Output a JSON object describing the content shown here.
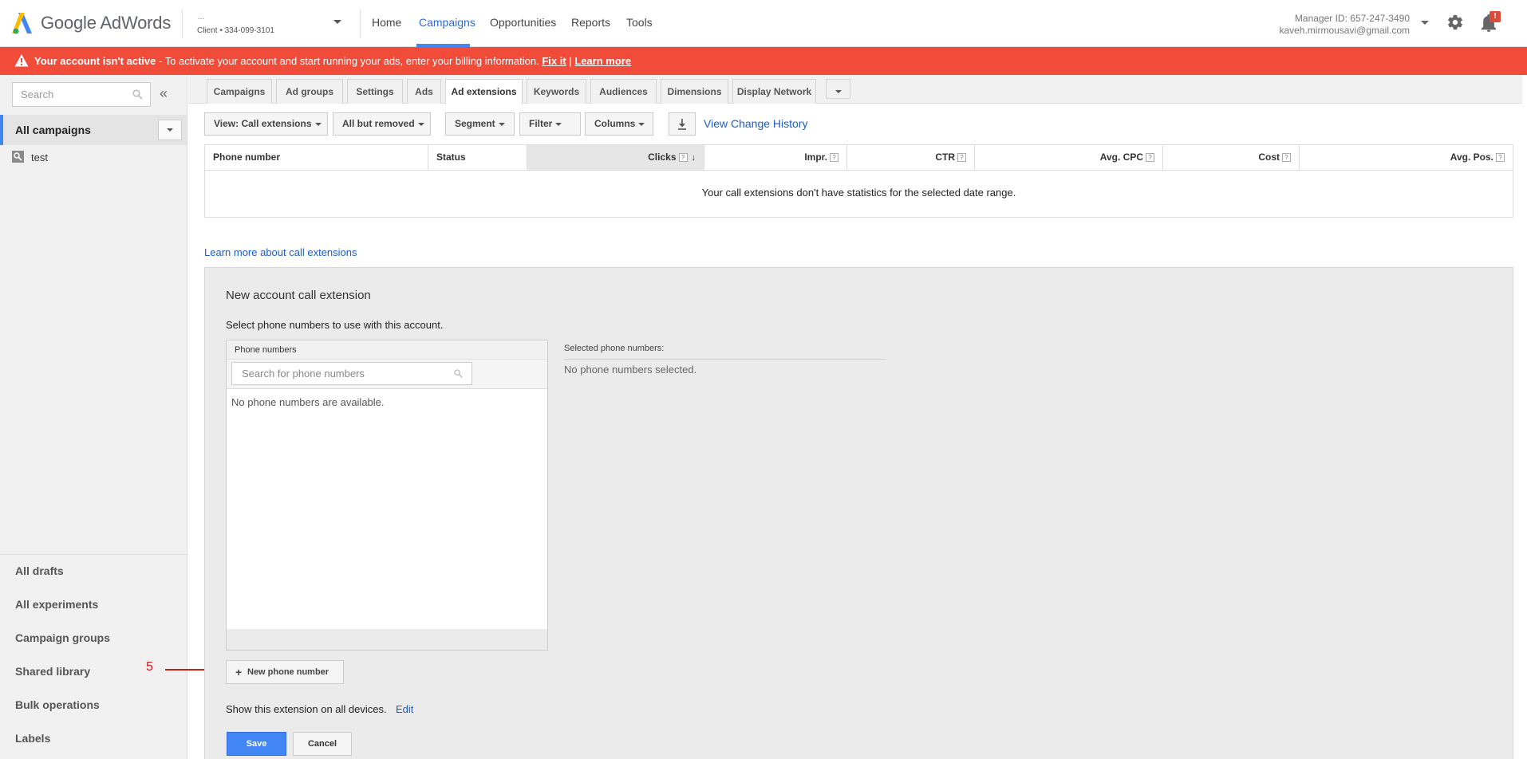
{
  "header": {
    "brand": "Google AdWords",
    "account_name": "...",
    "account_client": "Client  •  334-099-3101",
    "nav": [
      "Home",
      "Campaigns",
      "Opportunities",
      "Reports",
      "Tools"
    ],
    "active_nav": "Campaigns",
    "manager_id": "Manager ID: 657-247-3490",
    "manager_email": "kaveh.mirmousavi@gmail.com",
    "notification_badge": "!"
  },
  "alert": {
    "bold": "Your account isn't active",
    "text": " - To activate your account and start running your ads, enter your billing information. ",
    "fix_link": "Fix it",
    "separator": " | ",
    "learn_link": "Learn more",
    "color": "#f14c3a"
  },
  "sidebar": {
    "search_placeholder": "Search",
    "collapse_glyph": "«",
    "all_campaigns": "All campaigns",
    "campaigns": [
      "test"
    ],
    "bottom_items": [
      "All drafts",
      "All experiments",
      "Campaign groups",
      "Shared library",
      "Bulk operations",
      "Labels"
    ]
  },
  "tabs": [
    "Campaigns",
    "Ad groups",
    "Settings",
    "Ads",
    "Ad extensions",
    "Keywords",
    "Audiences",
    "Dimensions",
    "Display Network"
  ],
  "active_tab": "Ad extensions",
  "toolbar": {
    "view": "View: Call extensions",
    "filter_state": "All but removed",
    "segment": "Segment",
    "filter": "Filter",
    "columns": "Columns",
    "change_history": "View Change History"
  },
  "table": {
    "columns": [
      "Phone number",
      "Status",
      "Clicks",
      "Impr.",
      "CTR",
      "Avg. CPC",
      "Cost",
      "Avg. Pos."
    ],
    "sorted_column": "Clicks",
    "help_glyph": "?",
    "sort_glyph": "↓",
    "empty_message": "Your call extensions don't have statistics for the selected date range."
  },
  "learn_more_call": "Learn more about call extensions",
  "panel": {
    "title": "New account call extension",
    "subtitle": "Select phone numbers to use with this account.",
    "phone_numbers_header": "Phone numbers",
    "phone_search_placeholder": "Search for phone numbers",
    "no_phones": "No phone numbers are available.",
    "selected_header": "Selected phone numbers:",
    "selected_empty": "No phone numbers selected.",
    "new_phone_plus": "+",
    "new_phone_button": "New phone number",
    "show_extension": "Show this extension on all devices.",
    "edit": "Edit",
    "save": "Save",
    "cancel": "Cancel"
  },
  "annotation": {
    "number": "5",
    "color": "#cc1b1b"
  },
  "colors": {
    "accent": "#4285f4",
    "link": "#1a5dc9",
    "alert": "#f14c3a"
  }
}
